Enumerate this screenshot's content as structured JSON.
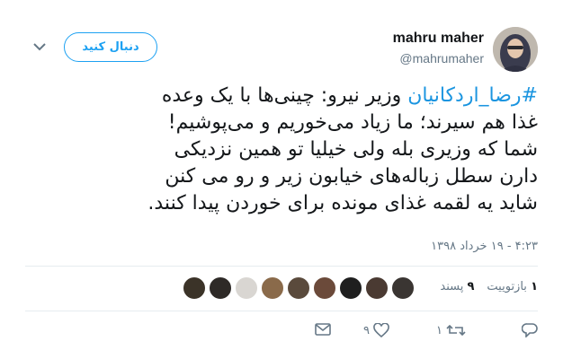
{
  "user": {
    "display_name": "mahru maher",
    "handle": "@mahrumaher"
  },
  "follow_button": {
    "label": "دنبال کنید"
  },
  "tweet": {
    "hashtag": "#رضا_اردکانیان",
    "lines": [
      " وزیر نیرو: چینی‌ها با یک وعده",
      "غذا هم سیرند؛ ما زیاد می‌خوریم و می‌پوشیم!",
      " شما که وزیری بله ولی خیلیا تو همین نزدیکی",
      "دارن سطل زباله‌های خیابون زیر و رو می کنن",
      "شاید یه لقمه غذای مونده برای خوردن پیدا کنند."
    ],
    "timestamp": "۴:۲۳ - ۱۹ خرداد ۱۳۹۸"
  },
  "stats": {
    "retweets_count": "۱",
    "retweets_label": "بازتوییت",
    "likes_count": "۹",
    "likes_label": "پسند"
  },
  "actions": {
    "reply_count": "",
    "retweet_count": "۱",
    "like_count": "۹"
  },
  "colors": {
    "accent": "#1da1f2",
    "hashtag": "#1b95e0",
    "text": "#14171a",
    "muted": "#657786",
    "divider": "#e6ecf0"
  },
  "liker_avatars": [
    "liker-1",
    "liker-2",
    "liker-3",
    "liker-4",
    "liker-5",
    "liker-6",
    "liker-7",
    "liker-8",
    "liker-9"
  ]
}
